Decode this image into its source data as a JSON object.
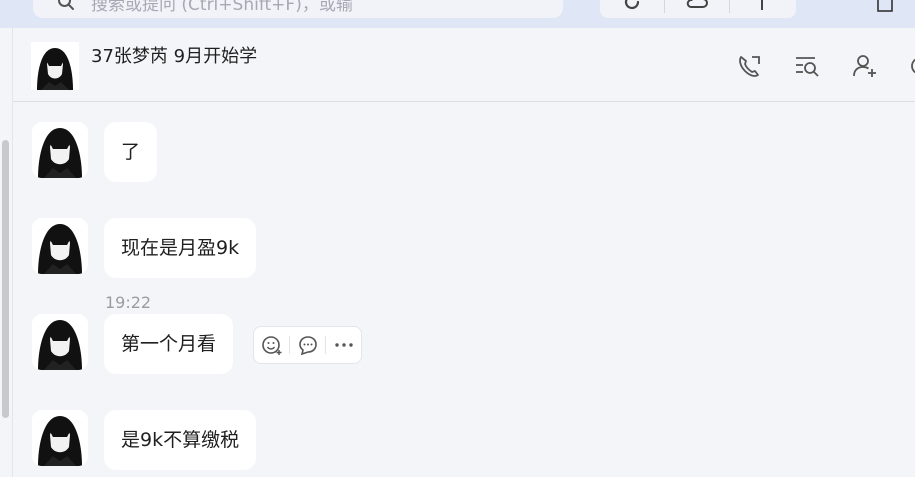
{
  "search": {
    "placeholder": "搜索或提问 (Ctrl+Shift+F)，或输",
    "icon": "search-icon"
  },
  "toolbar": {
    "icons": [
      "refresh-icon",
      "cloud-sync-icon",
      "add-icon"
    ]
  },
  "chat": {
    "title": "37张梦芮 9月开始学",
    "header_icons": [
      "voice-call-icon",
      "search-history-icon",
      "add-member-icon",
      "settings-icon"
    ]
  },
  "messages": [
    {
      "text": "了"
    },
    {
      "text": "现在是月盈9k"
    },
    {
      "text": "第一个月看",
      "time": "19:22"
    },
    {
      "text": "是9k不算缴税"
    }
  ],
  "message_actions": [
    "add-reaction-icon",
    "reply-icon",
    "more-icon"
  ]
}
